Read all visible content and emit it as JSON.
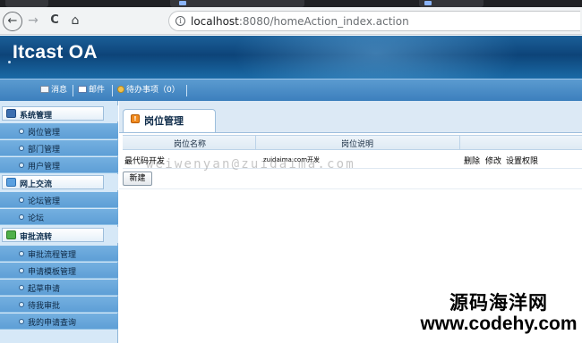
{
  "browser": {
    "address": {
      "host": "localhost",
      "path": ":8080/homeAction_index.action"
    }
  },
  "header": {
    "app_title": "Itcast OA",
    "quick_links": [
      {
        "label": "消息",
        "icon": "message-icon"
      },
      {
        "label": "邮件",
        "icon": "mail-icon"
      },
      {
        "label": "待办事项（0）",
        "icon": "todo-icon"
      }
    ]
  },
  "sidebar": {
    "groups": [
      {
        "label": "系统管理",
        "icon": "system-icon",
        "items": [
          "岗位管理",
          "部门管理",
          "用户管理"
        ]
      },
      {
        "label": "网上交流",
        "icon": "chat-icon",
        "items": [
          "论坛管理",
          "论坛"
        ]
      },
      {
        "label": "审批流转",
        "icon": "workflow-icon",
        "items": [
          "审批流程管理",
          "申请模板管理",
          "起草申请",
          "待我审批",
          "我的申请查询"
        ]
      }
    ]
  },
  "main": {
    "title": "岗位管理",
    "table": {
      "columns": [
        "岗位名称",
        "岗位说明"
      ],
      "rows": [
        {
          "name": "最代码开发",
          "desc": "zuidaima.com开发",
          "actions": [
            "删除",
            "修改",
            "设置权限"
          ]
        }
      ]
    },
    "new_button": "新建"
  },
  "overlay": {
    "watermark": "weiwenyan@zuidaima.com",
    "site_name": "源码海洋网",
    "site_url": "www.codehy.com"
  },
  "colors": {
    "header_blue": "#0d4479",
    "sidebar_item": "#6aa8dc",
    "sidebar_bg": "#d6e8f7",
    "title_icon": "#f08a1d"
  }
}
